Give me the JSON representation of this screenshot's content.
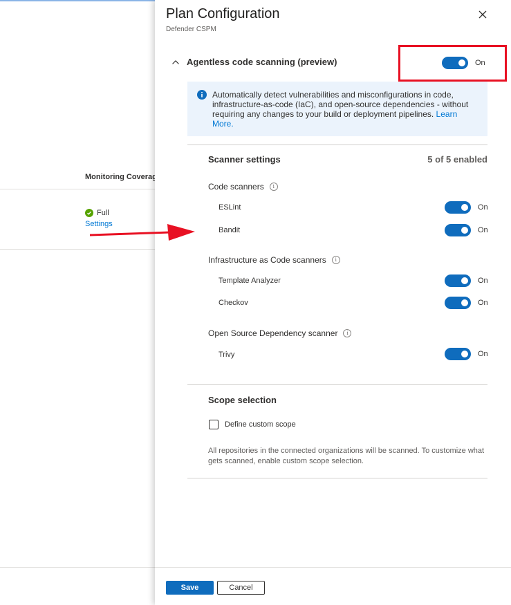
{
  "background": {
    "column_header": "Monitoring Coverage",
    "coverage_status": "Full",
    "settings_link": "Settings"
  },
  "panel": {
    "title": "Plan Configuration",
    "subtitle": "Defender CSPM",
    "section": {
      "title": "Agentless code scanning (preview)",
      "toggle_label": "On",
      "info_text": "Automatically detect vulnerabilities and misconfigurations in code, infrastructure-as-code (IaC), and open-source dependencies - without requiring any changes to your build or deployment pipelines.",
      "info_link": "Learn More."
    },
    "scanner_settings": {
      "title": "Scanner settings",
      "count": "5 of 5 enabled",
      "groups": [
        {
          "label": "Code scanners",
          "items": [
            {
              "name": "ESLint",
              "state": "On"
            },
            {
              "name": "Bandit",
              "state": "On"
            }
          ]
        },
        {
          "label": "Infrastructure as Code scanners",
          "items": [
            {
              "name": "Template Analyzer",
              "state": "On"
            },
            {
              "name": "Checkov",
              "state": "On"
            }
          ]
        },
        {
          "label": "Open Source Dependency scanner",
          "items": [
            {
              "name": "Trivy",
              "state": "On"
            }
          ]
        }
      ]
    },
    "scope": {
      "title": "Scope selection",
      "checkbox_label": "Define custom scope",
      "description": "All repositories in the connected organizations will be scanned. To customize what gets scanned, enable custom scope selection."
    },
    "footer": {
      "save": "Save",
      "cancel": "Cancel"
    }
  },
  "colors": {
    "accent": "#0f6cbd",
    "highlight": "#e81123",
    "success": "#57a300",
    "info_bg": "#ebf3fc"
  }
}
